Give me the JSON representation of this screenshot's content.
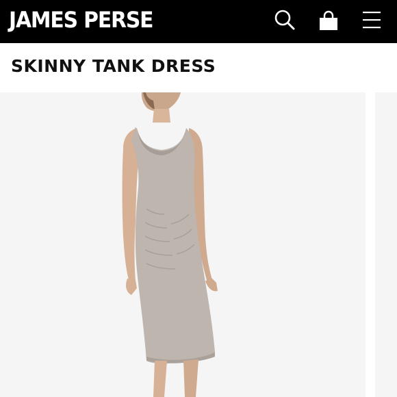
{
  "header": {
    "brand": "JAMES PERSE",
    "icons": [
      "search-icon",
      "shopping-bag-icon",
      "hamburger-menu-icon"
    ],
    "background_color": "#000000"
  },
  "product": {
    "title": "SKINNY TANK DRESS",
    "dress_color": "#bdb5ae"
  }
}
